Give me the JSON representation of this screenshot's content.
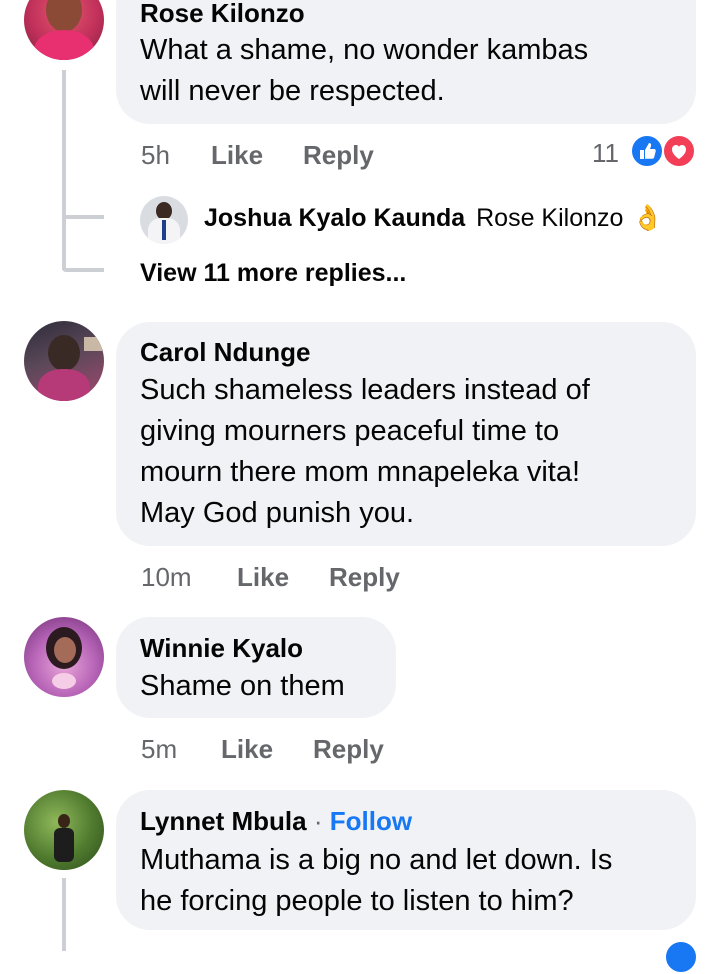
{
  "comments": [
    {
      "author": "Rose Kilonzo",
      "text_lines": [
        "What a shame, no wonder kambas",
        "will never be respected."
      ],
      "time": "5h",
      "like": "Like",
      "reply": "Reply",
      "reaction_count": "11",
      "reply_preview": {
        "author": "Joshua Kyalo Kaunda",
        "mention": "Rose Kilonzo",
        "emoji": "👌"
      },
      "view_more": "View 11 more replies..."
    },
    {
      "author": "Carol Ndunge",
      "text_lines": [
        "Such shameless leaders instead of",
        "giving mourners peaceful time to",
        "mourn there mom mnapeleka vita!",
        "May God punish you."
      ],
      "time": "10m",
      "like": "Like",
      "reply": "Reply"
    },
    {
      "author": "Winnie Kyalo",
      "text_lines": [
        "Shame on them"
      ],
      "time": "5m",
      "like": "Like",
      "reply": "Reply"
    },
    {
      "author": "Lynnet Mbula",
      "separator": "·",
      "follow": "Follow",
      "text_lines": [
        "Muthama is a big no and let down. Is",
        "he forcing people to listen to him?"
      ]
    }
  ],
  "colors": {
    "bubble": "#f0f2f5",
    "meta": "#65676b",
    "like_blue": "#1877f2",
    "love_red": "#f33e58"
  },
  "icons": [
    "like-reaction-icon",
    "love-reaction-icon"
  ]
}
